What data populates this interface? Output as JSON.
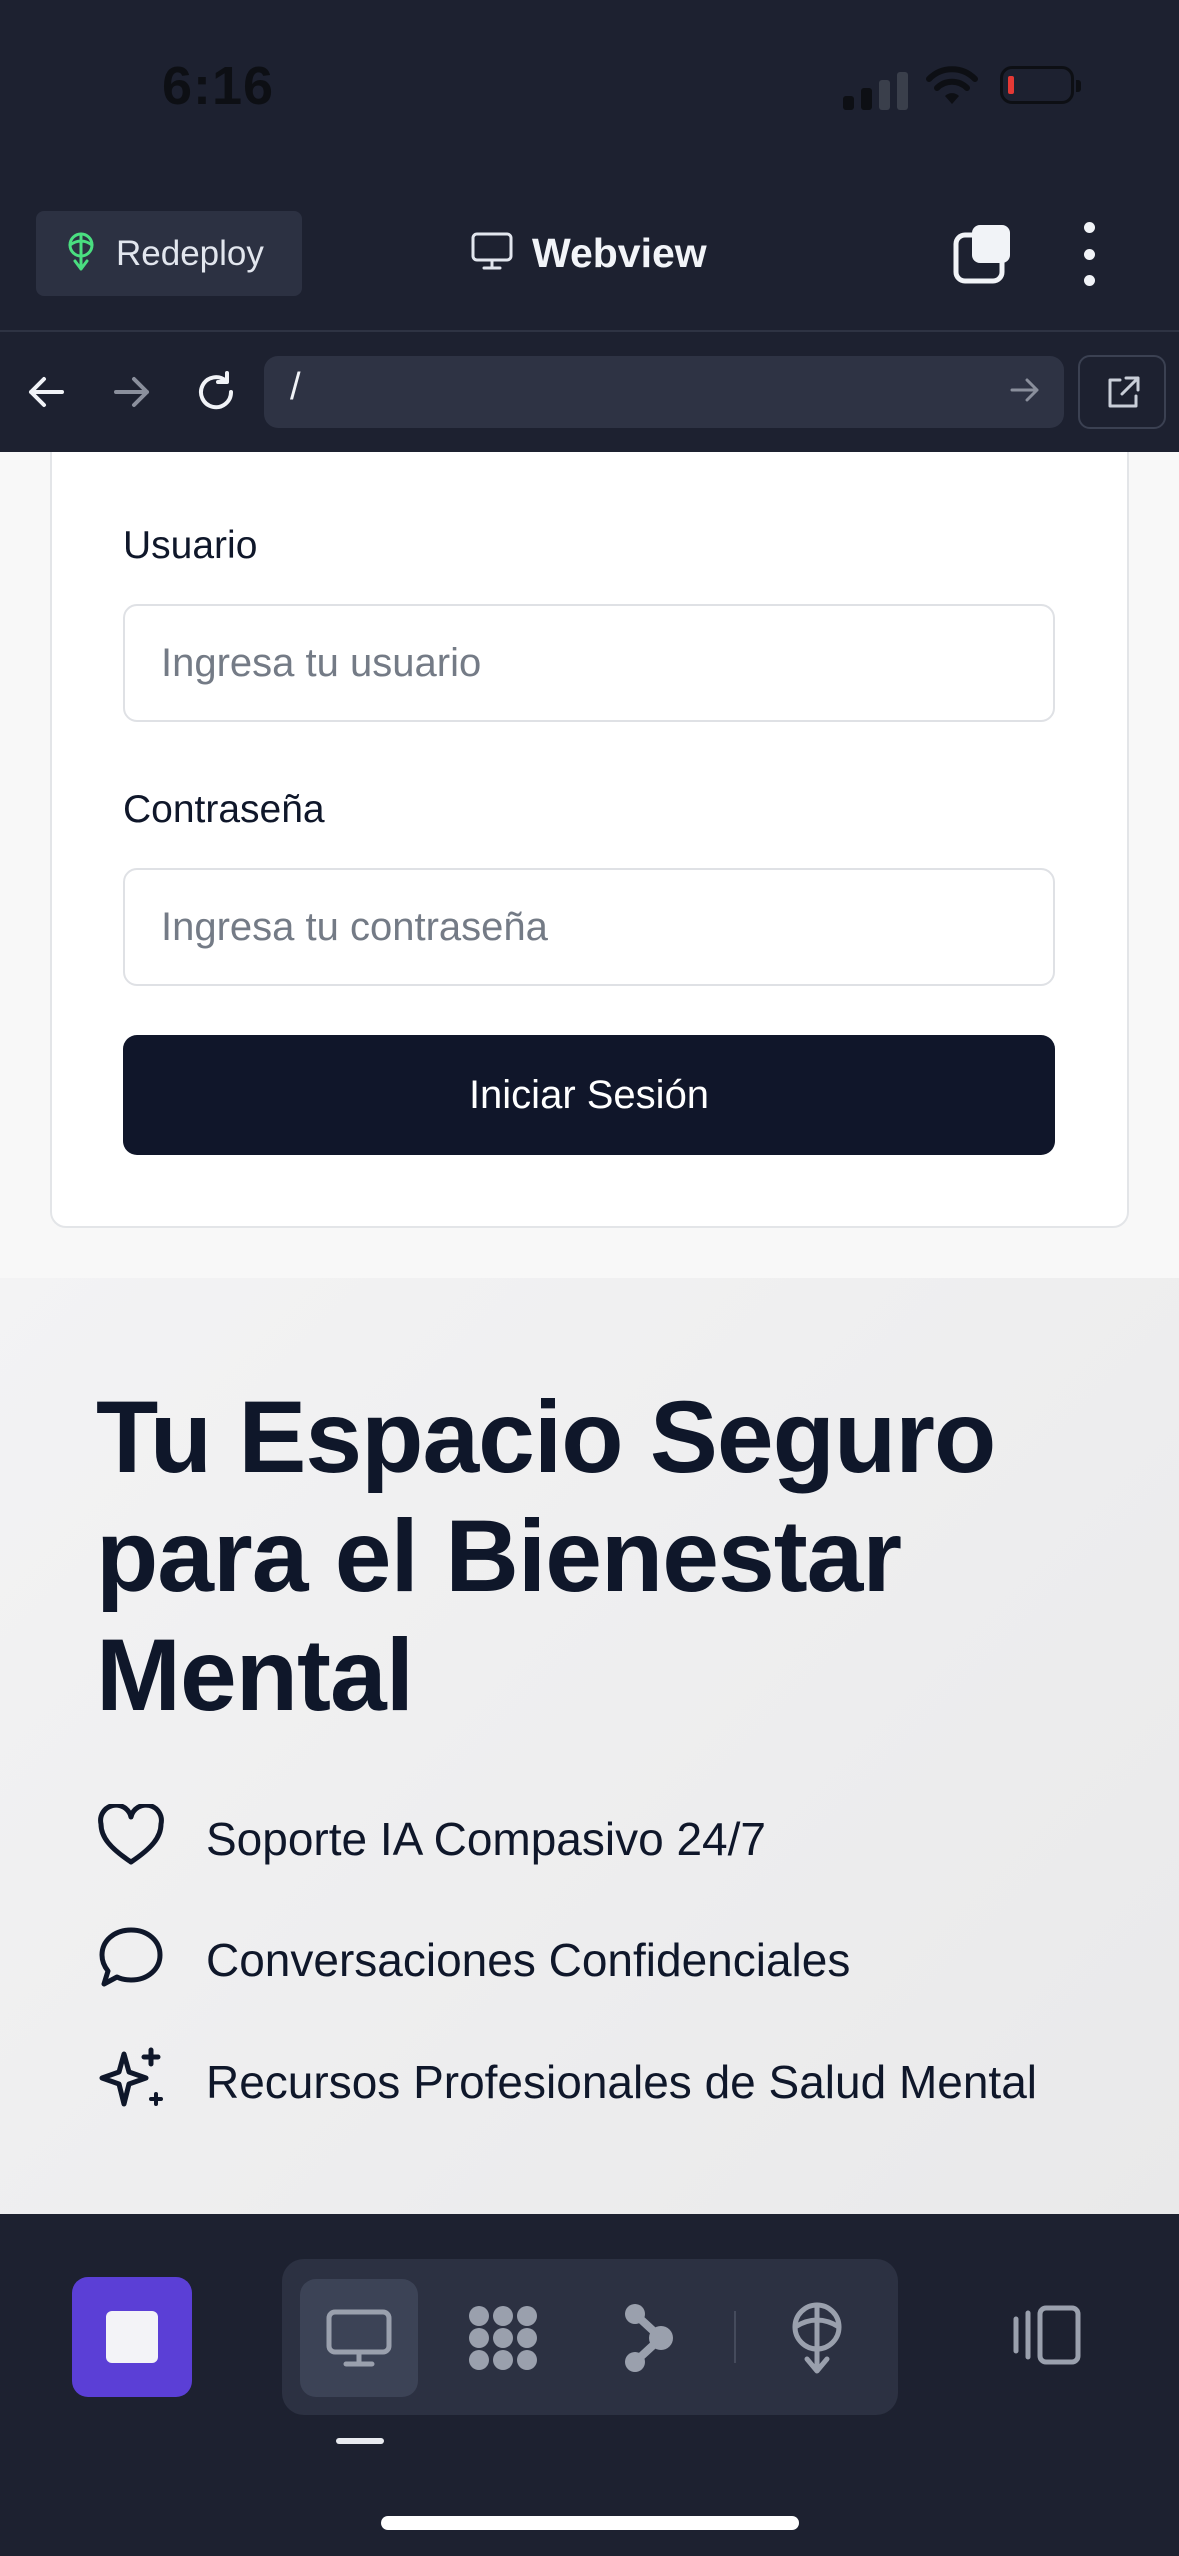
{
  "status_bar": {
    "time": "6:16"
  },
  "header": {
    "redeploy_label": "Redeploy",
    "title": "Webview",
    "accent_color": "#4ade80"
  },
  "nav": {
    "url": "/"
  },
  "login_form": {
    "username_label": "Usuario",
    "username_placeholder": "Ingresa tu usuario",
    "username_value": "",
    "password_label": "Contraseña",
    "password_placeholder": "Ingresa tu contraseña",
    "password_value": "",
    "submit_label": "Iniciar Sesión"
  },
  "hero": {
    "title": "Tu Espacio Seguro para el Bienestar Mental",
    "features": [
      {
        "icon": "heart-icon",
        "text": "Soporte IA Compasivo 24/7"
      },
      {
        "icon": "chat-bubble-icon",
        "text": "Conversaciones Confidenciales"
      },
      {
        "icon": "sparkles-icon",
        "text": "Recursos Profesionales de Salud Mental"
      }
    ]
  },
  "toolbar": {
    "stop_color": "#5b3fd6",
    "tools": [
      "desktop-icon",
      "grid-icon",
      "git-branch-icon",
      "deploy-icon"
    ],
    "active_tool": "desktop-icon"
  },
  "colors": {
    "chrome_bg": "#1d2130",
    "primary_button": "#10162a",
    "text_primary": "#0f172a"
  }
}
